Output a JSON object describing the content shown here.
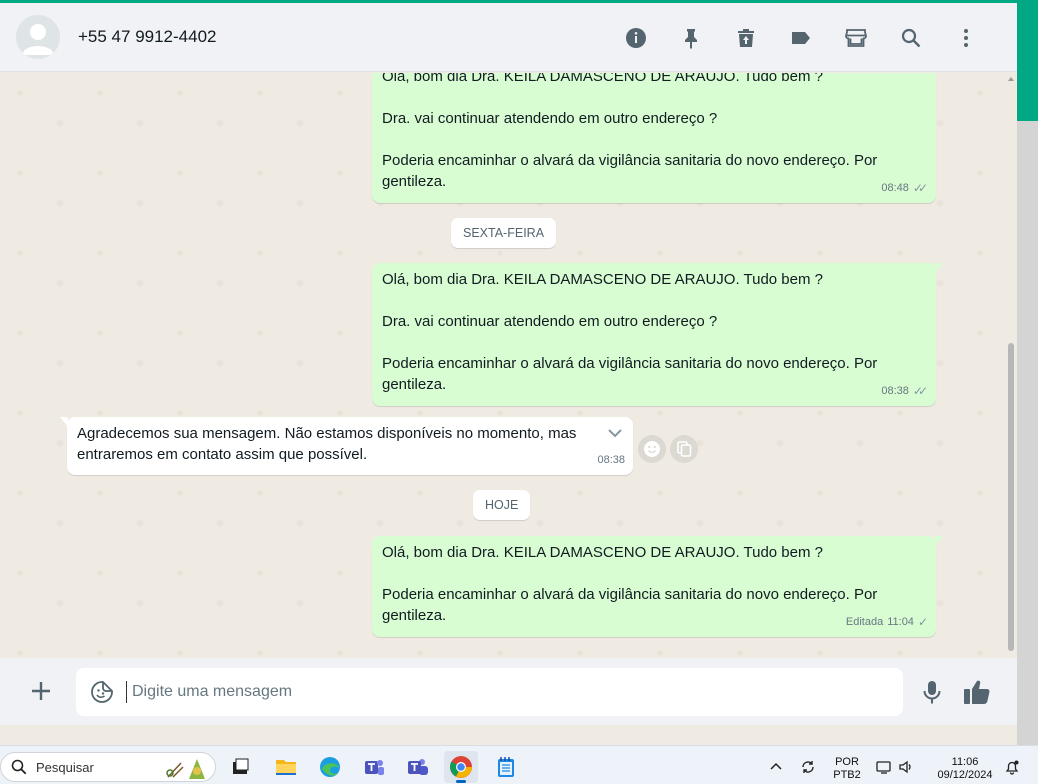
{
  "header": {
    "contact_name": "+55 47 9912-4402",
    "icons": [
      "info-icon",
      "pin-icon",
      "delete-icon",
      "label-icon",
      "catalog-icon",
      "search-icon",
      "menu-icon"
    ]
  },
  "messages": [
    {
      "direction": "out",
      "text": "Olá, bom dia Dra. KEILA DAMASCENO DE ARAUJO. Tudo bem ?\n\nDra. vai continuar atendendo em outro endereço ?\n\nPoderia encaminhar o alvará da vigilância sanitaria do novo endereço. Por gentileza.",
      "time": "08:48",
      "status": "read"
    },
    {
      "direction": "out_date",
      "text": "SEXTA-FEIRA"
    },
    {
      "direction": "out",
      "text": "Olá, bom dia Dra. KEILA DAMASCENO DE ARAUJO. Tudo bem ?\n\nDra. vai continuar atendendo em outro endereço ?\n\nPoderia encaminhar o alvará da vigilância sanitaria do novo endereço. Por gentileza.",
      "time": "08:38",
      "status": "read"
    },
    {
      "direction": "in",
      "text": "Agradecemos sua mensagem. Não estamos disponíveis no momento, mas entraremos em contato assim que possível.",
      "time": "08:38"
    },
    {
      "direction": "out_date",
      "text": "HOJE"
    },
    {
      "direction": "out",
      "text": "Olá, bom dia Dra. KEILA DAMASCENO DE ARAUJO. Tudo bem ?\n\nPoderia encaminhar o alvará da vigilância sanitaria do novo endereço. Por gentileza.",
      "time": "11:04",
      "edited_label": "Editada",
      "status": "sent"
    }
  ],
  "composer": {
    "placeholder": "Digite uma mensagem"
  },
  "taskbar": {
    "search_label": "Pesquisar",
    "lang_line1": "POR",
    "lang_line2": "PTB2",
    "time": "11:06",
    "date": "09/12/2024"
  },
  "colors": {
    "accent": "#00a884",
    "outgoing_bubble": "#d9fdd3",
    "incoming_bubble": "#ffffff",
    "chat_bg": "#efeae2"
  }
}
